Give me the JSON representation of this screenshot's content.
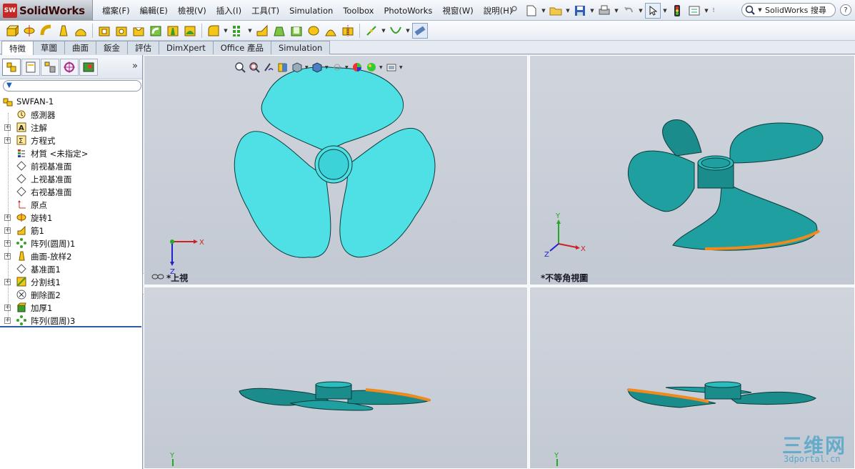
{
  "app": {
    "logo_text": "SolidWorks",
    "logo_badge": "SW"
  },
  "menus": [
    "檔案(F)",
    "編輯(E)",
    "檢視(V)",
    "插入(I)",
    "工具(T)",
    "Simulation",
    "Toolbox",
    "PhotoWorks",
    "視窗(W)",
    "說明(H)"
  ],
  "search": {
    "value": "SolidWorks 搜尋",
    "help": "?"
  },
  "tabs": [
    "特徵",
    "草圖",
    "曲面",
    "鈑金",
    "評估",
    "DimXpert",
    "Office 產品",
    "Simulation"
  ],
  "tree": {
    "root": "SWFAN-1",
    "items": [
      {
        "label": "感測器",
        "expandable": false
      },
      {
        "label": "注解",
        "expandable": true
      },
      {
        "label": "方程式",
        "expandable": true
      },
      {
        "label": "材質 <未指定>",
        "expandable": false
      },
      {
        "label": "前视基准面",
        "expandable": false
      },
      {
        "label": "上视基准面",
        "expandable": false
      },
      {
        "label": "右视基准面",
        "expandable": false
      },
      {
        "label": "原点",
        "expandable": false
      },
      {
        "label": "旋转1",
        "expandable": true
      },
      {
        "label": "筋1",
        "expandable": true
      },
      {
        "label": "阵列(圆周)1",
        "expandable": true
      },
      {
        "label": "曲面-放样2",
        "expandable": true
      },
      {
        "label": "基准面1",
        "expandable": false
      },
      {
        "label": "分割线1",
        "expandable": true
      },
      {
        "label": "删除面2",
        "expandable": false
      },
      {
        "label": "加厚1",
        "expandable": true
      },
      {
        "label": "阵列(圆周)3",
        "expandable": true
      }
    ]
  },
  "viewports": {
    "top": "*上視",
    "iso": "*不等角視圖"
  },
  "axes": {
    "x": "X",
    "y": "Y",
    "z": "Z"
  },
  "watermark": {
    "big": "三维网",
    "small": "3dportal.cn"
  },
  "colors": {
    "fan_face": "#4fe0e6",
    "fan_side": "#1a8c8c",
    "edge_highlight": "#f08a1a",
    "background": "#c9ced7"
  }
}
